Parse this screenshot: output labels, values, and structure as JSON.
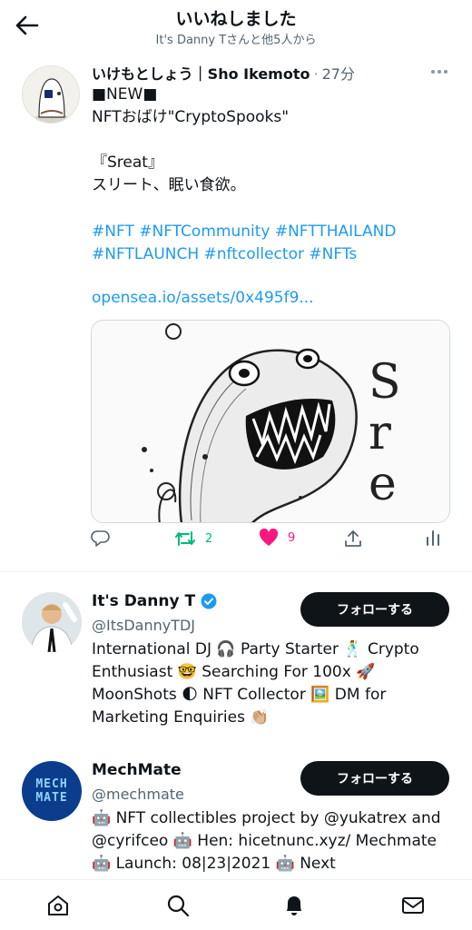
{
  "header": {
    "title": "いいねしました",
    "subtitle": "It's Danny Tさんと他5人から"
  },
  "tweet": {
    "author_name": "いけもとしょう｜Sho Ikemoto",
    "time": "27分",
    "text": "■NEW■\nNFTおばけ\"CryptoSpooks\"\n\n『Sreat』\nスリート、眠い食欲。",
    "hashtags": "#NFT #NFTCommunity #NFTTHAILAND #NFTLAUNCH #nftcollector #NFTs",
    "link": "opensea.io/assets/0x495f9...",
    "media_text": "Sreat",
    "retweets": "2",
    "likes": "9"
  },
  "users": [
    {
      "name": "It's Danny T",
      "handle": "@ItsDannyTDJ",
      "verified": true,
      "follow_label": "フォローする",
      "bio": "International DJ 🎧 Party Starter 🕺 Crypto Enthusiast 🤓 Searching For 100x 🚀 MoonShots 🌓 NFT Collector 🖼️ DM for Marketing Enquiries 👏🏼"
    },
    {
      "name": "MechMate",
      "handle": "@mechmate",
      "verified": false,
      "follow_label": "フォローする",
      "avatar_text": "MECH MATE",
      "bio": "🤖 NFT collectibles project by @yukatrex and @cyrifceo 🤖 Hen: hicetnunc.xyz/ Mechmate 🤖 Launch: 08|23|2021 🤖 Next"
    }
  ],
  "colors": {
    "accent": "#1d9bf0",
    "retweet": "#00ba7c",
    "like": "#f91880",
    "text": "#0f1419",
    "muted": "#536471"
  }
}
